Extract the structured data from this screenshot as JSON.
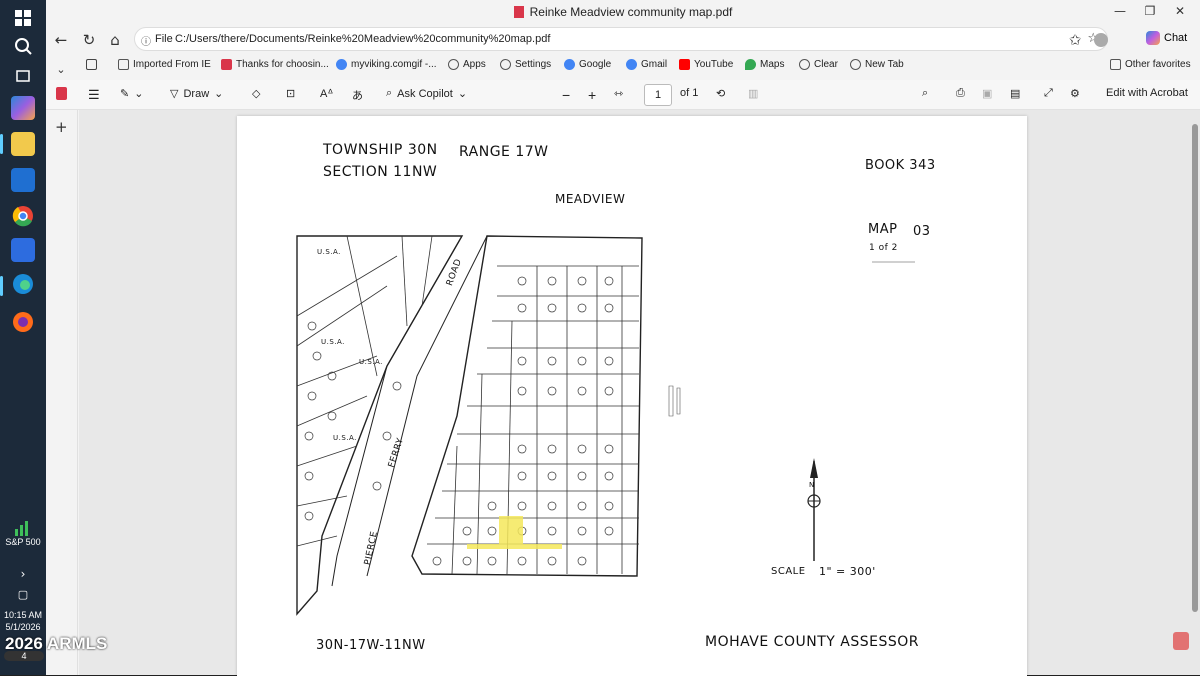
{
  "taskbar": {
    "sp500_label": "S&P 500",
    "time": "10:15 AM",
    "date": "5/1/2026",
    "watermark": "2026 ARMLS",
    "badge": "4"
  },
  "window": {
    "title": "Reinke Meadview community map.pdf"
  },
  "address": {
    "scheme_label": "File",
    "url": "C:/Users/there/Documents/Reinke%20Meadview%20community%20map.pdf"
  },
  "chat_label": "Chat",
  "favorites": [
    {
      "label": "Imported From IE",
      "icon": "folder-icon",
      "color": "#e8b84a"
    },
    {
      "label": "Thanks for choosin...",
      "icon": "brand-icon",
      "color": "#d9364a"
    },
    {
      "label": "myviking.comgif -...",
      "icon": "google-icon",
      "color": "#4285f4"
    },
    {
      "label": "Apps",
      "icon": "globe-icon",
      "color": "#555555"
    },
    {
      "label": "Settings",
      "icon": "globe-icon",
      "color": "#555555"
    },
    {
      "label": "Google",
      "icon": "google-icon",
      "color": "#4285f4"
    },
    {
      "label": "Gmail",
      "icon": "google-icon",
      "color": "#4285f4"
    },
    {
      "label": "YouTube",
      "icon": "youtube-icon",
      "color": "#ff0000"
    },
    {
      "label": "Maps",
      "icon": "maps-icon",
      "color": "#34a853"
    },
    {
      "label": "Clear",
      "icon": "globe-icon",
      "color": "#555555"
    },
    {
      "label": "New Tab",
      "icon": "globe-icon",
      "color": "#555555"
    }
  ],
  "other_favorites": "Other favorites",
  "pdf_toolbar": {
    "draw_label": "Draw",
    "ask_copilot_label": "Ask Copilot",
    "page_current": "1",
    "page_total": "of 1",
    "edit_acrobat_label": "Edit with Acrobat"
  },
  "map": {
    "township": "TOWNSHIP 30N",
    "range": "RANGE 17W",
    "section": "SECTION 11NW",
    "book": "BOOK 343",
    "meadview": "MEADVIEW",
    "map_label": "MAP",
    "map_number": "03",
    "page_of": "1 of 2",
    "road_label": "ROAD",
    "ferry_label": "FERRY",
    "pierce_label": "PIERCE",
    "scale": "SCALE",
    "scale_value": "1\" = 300'",
    "north": "N",
    "footer_code": "30N-17W-11NW",
    "assessor": "MOHAVE COUNTY ASSESSOR",
    "usa_label": "U.S.A."
  },
  "colors": {
    "highlight": "#f5e85a",
    "accent": "#60cdff"
  }
}
